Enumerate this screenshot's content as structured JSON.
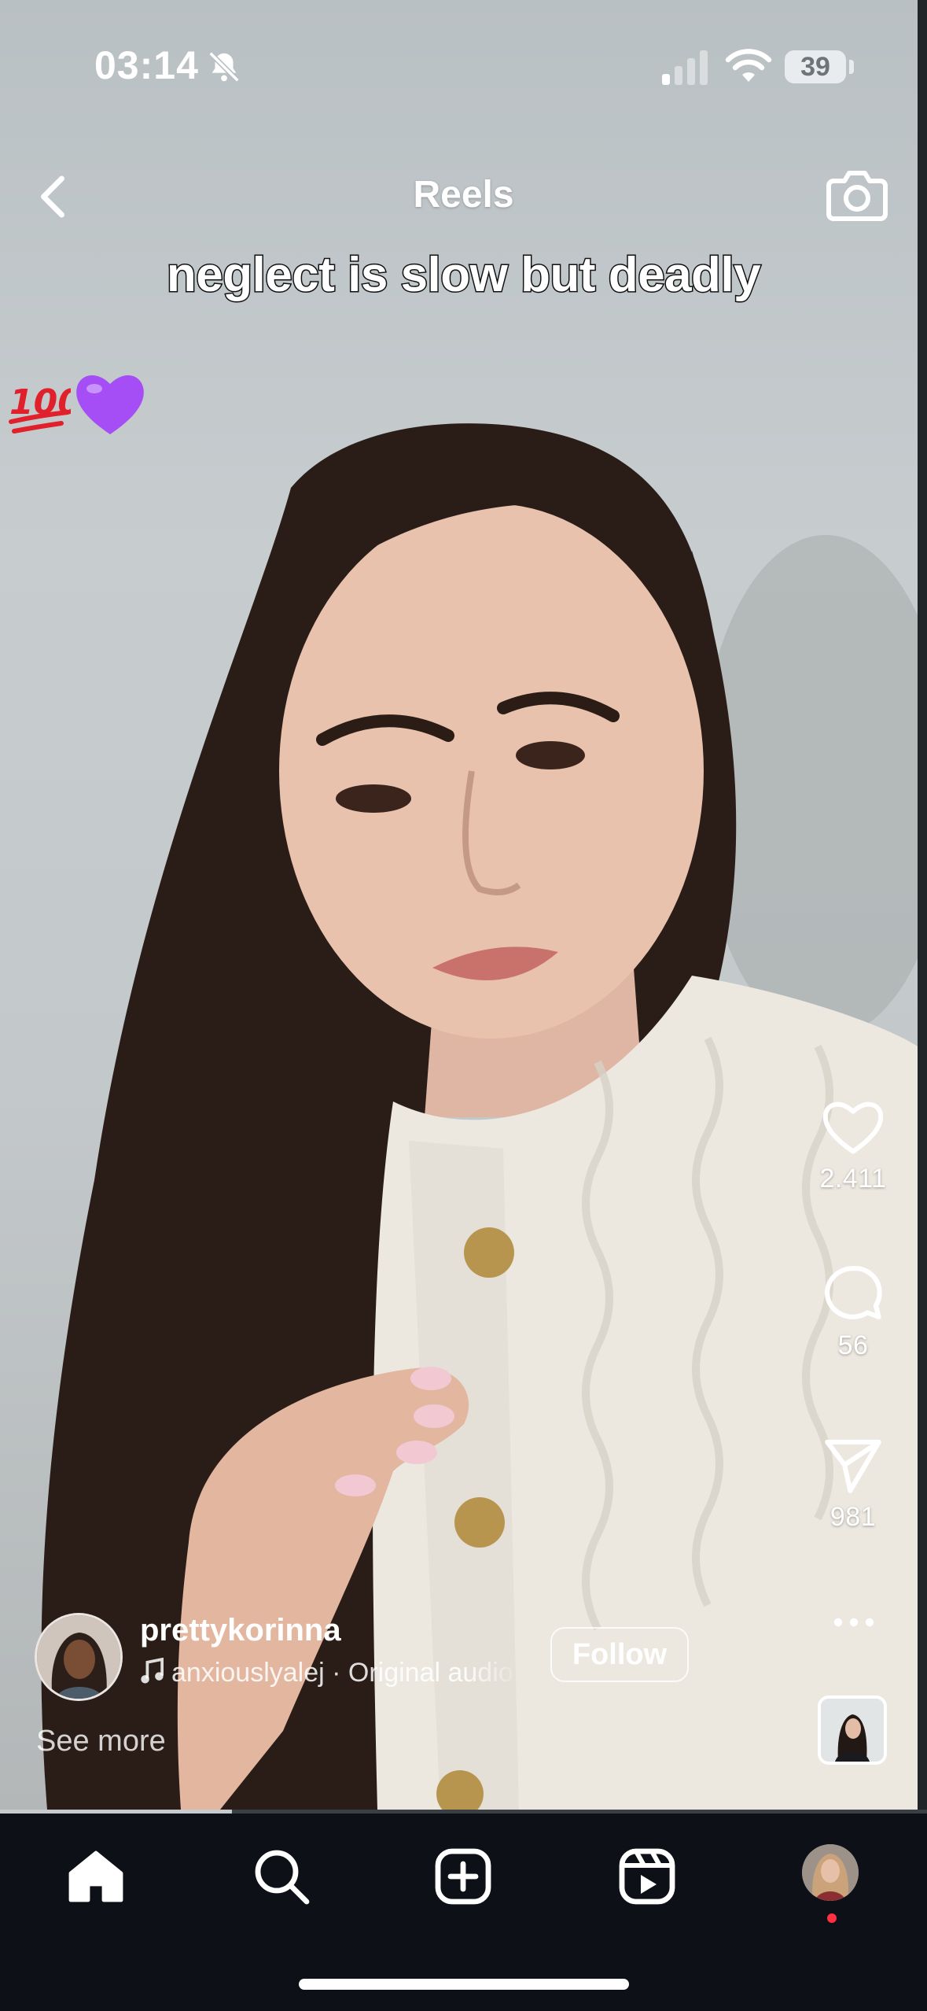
{
  "status_bar": {
    "time": "03:14",
    "battery": "39",
    "icons": [
      "bell-off-icon",
      "cellular-signal-icon",
      "wifi-icon",
      "battery-icon"
    ]
  },
  "header": {
    "title": "Reels",
    "back_icon": "chevron-left-icon",
    "camera_icon": "camera-icon"
  },
  "video": {
    "caption": "neglect is slow but deadly",
    "emojis": [
      "hundred-points-emoji",
      "purple-heart-emoji"
    ],
    "progress": 0.25
  },
  "actions": {
    "likes": "2.411",
    "comments": "56",
    "shares": "981",
    "more_icon": "more-horizontal-icon"
  },
  "author": {
    "username": "prettykorinna",
    "audio": "anxiouslyalej · Original audio",
    "follow_label": "Follow",
    "see_more": "See more"
  },
  "tabbar": {
    "items": [
      "home-icon",
      "search-icon",
      "create-icon",
      "reels-icon",
      "profile-avatar"
    ],
    "active": "home-icon"
  },
  "colors": {
    "tabbar_bg": "#0d1117",
    "notification_dot": "#ff3040",
    "purple_heart": "#a64ef5",
    "hundred_red": "#e0202a"
  }
}
